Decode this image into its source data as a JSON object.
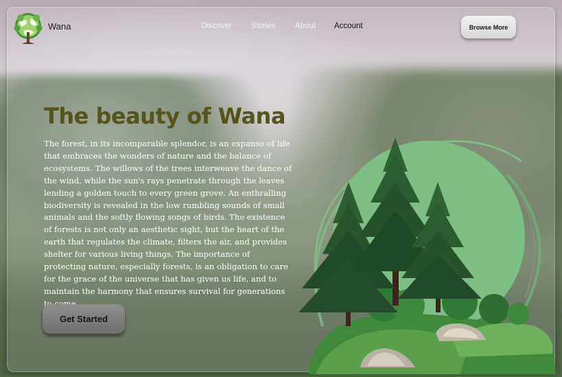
{
  "brand": {
    "name": "Wana",
    "logo_icon": "tree-globe-icon"
  },
  "nav": {
    "items": [
      {
        "label": "Discover"
      },
      {
        "label": "Stories"
      },
      {
        "label": "About"
      },
      {
        "label": "Account",
        "active": true
      }
    ]
  },
  "header": {
    "browse_label": "Browse More"
  },
  "hero": {
    "title": "The beauty of Wana",
    "body": "The forest, in its incomparable splendor, is an expanse of life that embraces the wonders of nature and the balance of ecosystems. The willows of the trees interweave the dance of the wind, while the sun's rays penetrate through the leaves lending a golden touch to every green grove. An enthralling biodiversity is revealed in the low rumbling sounds of small animals and the softly flowing songs of birds. The existence of forests is not only an aesthetic sight, but the heart of the earth that regulates the climate, filters the air, and provides shelter for various living things. The importance of protecting nature, especially forests, is an obligation to care for the grace of the universe that has given us life, and to maintain the harmony that ensures survival for generations to come.",
    "cta_label": "Get Started",
    "illustration_icon": "pine-trees-illustration"
  },
  "colors": {
    "title": "#56541a",
    "body_text": "#ffffff",
    "nav_active": "#111111",
    "nav_inactive": "#f4f1f3",
    "illustration_circle": "#7fbf86"
  }
}
